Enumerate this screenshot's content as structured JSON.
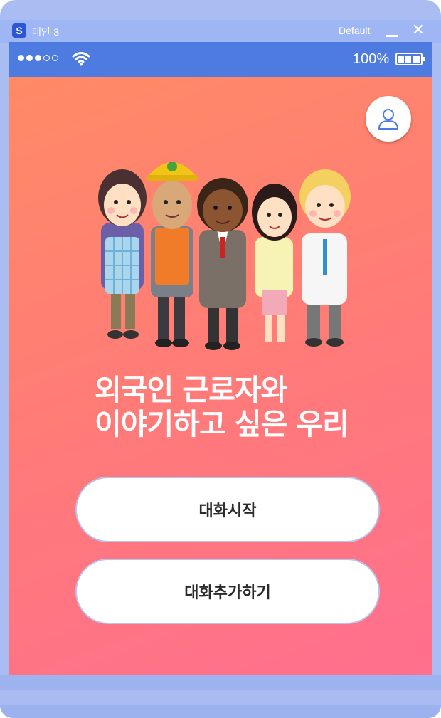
{
  "window": {
    "app_icon_letter": "S",
    "title": "메인-3",
    "mode": "Default",
    "close_glyph": "✕"
  },
  "status_bar": {
    "signal_dots_filled": 3,
    "signal_dots_total": 5,
    "battery_percent": "100%",
    "battery_level": 1.0
  },
  "main": {
    "headline_line1": "외국인 근로자와",
    "headline_line2": "이야기하고 싶은 우리",
    "start_button": "대화시작",
    "add_button": "대화추가하기"
  },
  "colors": {
    "status_bar": "#4d7be0",
    "window_frame": "#a9bdf3",
    "gradient_start": "#ff8a66",
    "gradient_end": "#ff6f8e",
    "profile_icon_stroke": "#4d7be0"
  },
  "icons": {
    "profile": "user-profile-icon",
    "wifi": "wifi-icon",
    "battery": "battery-icon",
    "minimize": "minimize-icon",
    "close": "close-icon"
  }
}
